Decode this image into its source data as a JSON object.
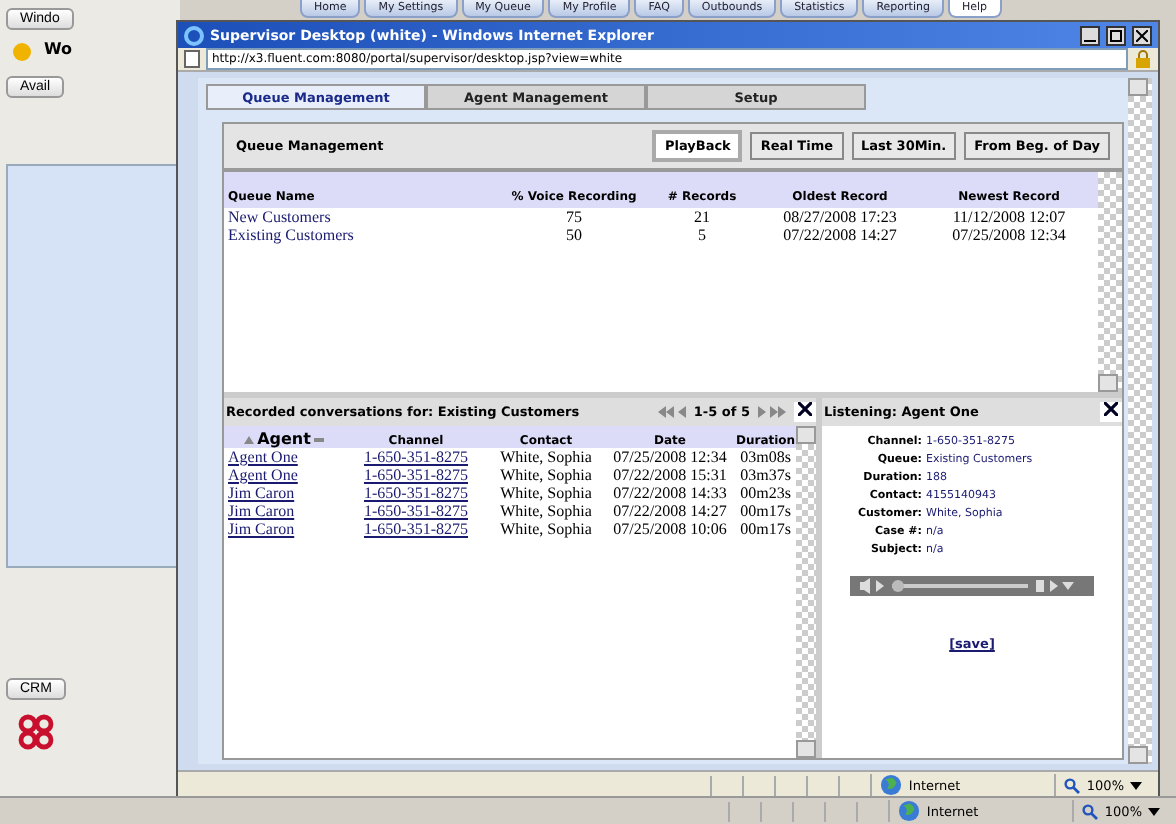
{
  "background_app": {
    "tabs": [
      {
        "label": "Home",
        "selected": false
      },
      {
        "label": "My Settings",
        "selected": false
      },
      {
        "label": "My Queue",
        "selected": false
      },
      {
        "label": "My Profile",
        "selected": false
      },
      {
        "label": "FAQ",
        "selected": false
      },
      {
        "label": "Outbounds",
        "selected": false
      },
      {
        "label": "Statistics",
        "selected": false
      },
      {
        "label": "Reporting",
        "selected": false
      },
      {
        "label": "Help",
        "selected": true
      }
    ],
    "window_button": "Windo",
    "welcome": "Wo",
    "status_button": "Avail",
    "crm_button": "CRM"
  },
  "browser": {
    "title": "Supervisor Desktop (white) - Windows Internet Explorer",
    "address": "http://x3.fluent.com:8080/portal/supervisor/desktop.jsp?view=white",
    "tabs": [
      {
        "label": "Queue Management",
        "selected": true
      },
      {
        "label": "Agent Management",
        "selected": false
      },
      {
        "label": "Setup",
        "selected": false
      }
    ],
    "panel_title": "Queue Management",
    "filters": [
      {
        "label": "PlayBack",
        "selected": true
      },
      {
        "label": "Real Time",
        "selected": false
      },
      {
        "label": "Last 30Min.",
        "selected": false
      },
      {
        "label": "From Beg. of Day",
        "selected": false
      }
    ],
    "queue_table": {
      "columns": [
        "Queue Name",
        "% Voice Recording",
        "# Records",
        "Oldest Record",
        "Newest Record"
      ],
      "rows": [
        {
          "cells": [
            "New Customers",
            "75",
            "21",
            "08/27/2008 17:23",
            "11/12/2008 12:07"
          ]
        },
        {
          "cells": [
            "Existing Customers",
            "50",
            "5",
            "07/22/2008 14:27",
            "07/25/2008 12:34"
          ]
        }
      ]
    },
    "recordings": {
      "title": "Recorded conversations for: Existing Customers",
      "pager": "1-5 of 5",
      "columns": [
        "Agent",
        "Channel",
        "Contact",
        "Date",
        "Duration"
      ],
      "rows": [
        [
          "Agent One",
          "1-650-351-8275",
          "White, Sophia",
          "07/25/2008 12:34",
          "03m08s"
        ],
        [
          "Agent One",
          "1-650-351-8275",
          "White, Sophia",
          "07/22/2008 15:31",
          "03m37s"
        ],
        [
          "Jim Caron",
          "1-650-351-8275",
          "White, Sophia",
          "07/22/2008 14:33",
          "00m23s"
        ],
        [
          "Jim Caron",
          "1-650-351-8275",
          "White, Sophia",
          "07/22/2008 14:27",
          "00m17s"
        ],
        [
          "Jim Caron",
          "1-650-351-8275",
          "White, Sophia",
          "07/25/2008 10:06",
          "00m17s"
        ]
      ]
    },
    "listening": {
      "title": "Listening: Agent One",
      "fields": [
        {
          "label": "Channel:",
          "value": "1-650-351-8275"
        },
        {
          "label": "Queue:",
          "value": "Existing Customers"
        },
        {
          "label": "Duration:",
          "value": "188"
        },
        {
          "label": "Contact:",
          "value": "4155140943"
        },
        {
          "label": "Customer:",
          "value": "White, Sophia"
        },
        {
          "label": "Case #:",
          "value": "n/a"
        },
        {
          "label": "Subject:",
          "value": "n/a"
        }
      ],
      "save_link": "[save]"
    },
    "status": {
      "zone": "Internet",
      "zoom": "100%"
    }
  },
  "outer_status": {
    "zone": "Internet",
    "zoom": "100%"
  }
}
